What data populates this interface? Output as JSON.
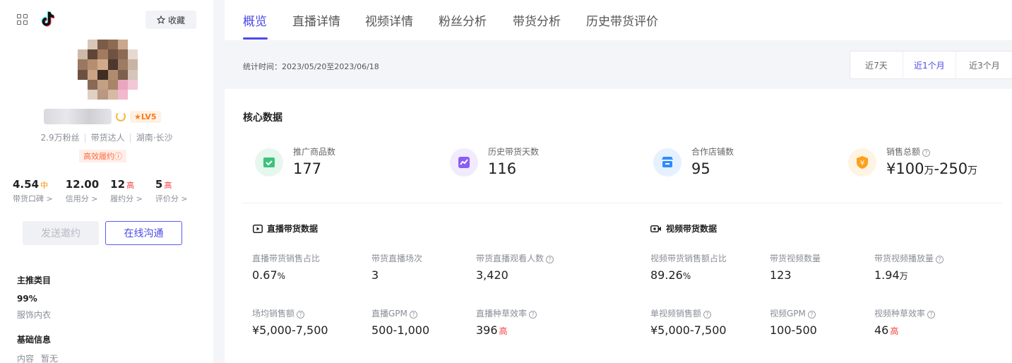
{
  "sidebar": {
    "fav_label": "收藏",
    "level_badge": "LV5",
    "fans": "2.9万粉丝",
    "role": "带货达人",
    "location": "湖南·长沙",
    "tag": "高效履约",
    "scores": [
      {
        "value": "4.54",
        "level": "中",
        "label": "带货口碑 >"
      },
      {
        "value": "12.00",
        "level": "",
        "label": "信用分 >"
      },
      {
        "value": "12",
        "level": "高",
        "label": "履约分 >"
      },
      {
        "value": "5",
        "level": "高",
        "label": "评价分 >"
      }
    ],
    "invite_label": "发送邀约",
    "chat_label": "在线沟通",
    "main_category_title": "主推类目",
    "main_category_pct": "99%",
    "main_category_name": "服饰内衣",
    "basic_info_title": "基础信息",
    "basic_info_key": "内容",
    "basic_info_value": "暂无"
  },
  "tabs": [
    "概览",
    "直播详情",
    "视频详情",
    "粉丝分析",
    "带货分析",
    "历史带货评价"
  ],
  "stats": {
    "time_label": "统计时间：2023/05/20至2023/06/18",
    "ranges": [
      "近7天",
      "近1个月",
      "近3个月"
    ]
  },
  "core": {
    "title": "核心数据",
    "items": [
      {
        "label": "推广商品数",
        "value": "177",
        "icon": "product-icon",
        "color": "#3cc47a"
      },
      {
        "label": "历史带货天数",
        "value": "116",
        "icon": "chart-icon",
        "color": "#8b5cf6"
      },
      {
        "label": "合作店铺数",
        "value": "95",
        "icon": "shop-icon",
        "color": "#2f8bff"
      },
      {
        "label": "销售总额",
        "value_a": "¥100",
        "unit_a": "万",
        "value_b": "-250",
        "unit_b": "万",
        "icon": "shield-money-icon",
        "color": "#ff9f1a"
      }
    ]
  },
  "live": {
    "title": "直播带货数据",
    "metrics": [
      {
        "label": "直播带货销售占比",
        "value": "0.67",
        "unit": "%"
      },
      {
        "label": "带货直播场次",
        "value": "3"
      },
      {
        "label": "带货直播观看人数",
        "value": "3,420"
      },
      {
        "label": "场均销售额",
        "value": "¥5,000-7,500"
      },
      {
        "label": "直播GPM",
        "value": "500-1,000"
      },
      {
        "label": "直播种草效率",
        "value": "396",
        "level": "高"
      }
    ]
  },
  "video": {
    "title": "视频带货数据",
    "metrics": [
      {
        "label": "视频带货销售额占比",
        "value": "89.26",
        "unit": "%"
      },
      {
        "label": "带货视频数量",
        "value": "123"
      },
      {
        "label": "带货视频播放量",
        "value": "1.94",
        "unit": "万"
      },
      {
        "label": "单视频销售额",
        "value": "¥5,000-7,500"
      },
      {
        "label": "视频GPM",
        "value": "100-500"
      },
      {
        "label": "视频种草效率",
        "value": "46",
        "level": "高"
      }
    ]
  }
}
